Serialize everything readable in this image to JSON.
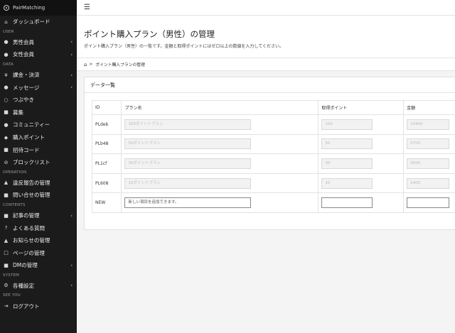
{
  "app": {
    "name": "PairMatching"
  },
  "sidebar": {
    "groups": [
      {
        "section": "",
        "items": [
          {
            "icon": "dashboard-icon",
            "glyph": "⌂",
            "label": "ダッシュボード",
            "chevron": false
          }
        ]
      },
      {
        "section": "USER",
        "items": [
          {
            "icon": "male-user-icon",
            "glyph": "●",
            "label": "男性会員",
            "chevron": true
          },
          {
            "icon": "female-user-icon",
            "glyph": "●",
            "label": "女性会員",
            "chevron": true
          }
        ]
      },
      {
        "section": "DATA",
        "items": [
          {
            "icon": "yen-icon",
            "glyph": "¥",
            "label": "課金・決済",
            "chevron": true
          },
          {
            "icon": "message-icon",
            "glyph": "●",
            "label": "メッセージ",
            "chevron": true
          },
          {
            "icon": "tweet-icon",
            "glyph": "○",
            "label": "つぶやき",
            "chevron": false
          },
          {
            "icon": "recruit-icon",
            "glyph": "■",
            "label": "募集",
            "chevron": false
          },
          {
            "icon": "community-icon",
            "glyph": "●",
            "label": "コミュニティー",
            "chevron": false
          },
          {
            "icon": "purchase-point-icon",
            "glyph": "◆",
            "label": "購入ポイント",
            "chevron": false
          },
          {
            "icon": "invite-code-icon",
            "glyph": "■",
            "label": "招待コード",
            "chevron": false
          },
          {
            "icon": "block-list-icon",
            "glyph": "⊘",
            "label": "ブロックリスト",
            "chevron": false
          }
        ]
      },
      {
        "section": "OPERATION",
        "items": [
          {
            "icon": "report-icon",
            "glyph": "▲",
            "label": "違反報告の管理",
            "chevron": false
          },
          {
            "icon": "inquiry-icon",
            "glyph": "■",
            "label": "問い合せの管理",
            "chevron": false
          }
        ]
      },
      {
        "section": "CONTENTS",
        "items": [
          {
            "icon": "article-icon",
            "glyph": "■",
            "label": "記事の管理",
            "chevron": true
          },
          {
            "icon": "faq-icon",
            "glyph": "?",
            "label": "よくある質問",
            "chevron": false
          },
          {
            "icon": "notice-icon",
            "glyph": "▲",
            "label": "お知らせの管理",
            "chevron": false
          },
          {
            "icon": "page-icon",
            "glyph": "□",
            "label": "ページの管理",
            "chevron": false
          },
          {
            "icon": "dm-icon",
            "glyph": "■",
            "label": "DMの管理",
            "chevron": true
          }
        ]
      },
      {
        "section": "SYSTEM",
        "items": [
          {
            "icon": "gear-icon",
            "glyph": "⚙",
            "label": "各種設定",
            "chevron": true
          }
        ]
      },
      {
        "section": "SEE YOU",
        "items": [
          {
            "icon": "logout-icon",
            "glyph": "⇥",
            "label": "ログアウト",
            "chevron": false
          }
        ]
      }
    ]
  },
  "header": {
    "title": "ポイント購入プラン（男性）の管理",
    "description": "ポイント購入プラン（男性）の一覧です。金額と取得ポイントにはゼロ以上の数値を入力してください。"
  },
  "breadcrumb": {
    "current": "ポイント購入プランの管理"
  },
  "card": {
    "title": "データ一覧",
    "columns": {
      "id": "ID",
      "plan_name": "プラン名",
      "points": "取得ポイント",
      "price": "金額"
    },
    "rows": [
      {
        "id": "PLdeb",
        "plan_name": "100ポイントプラン",
        "points": "100",
        "price": "10400"
      },
      {
        "id": "PLb48",
        "plan_name": "50ポイントプラン",
        "points": "50",
        "price": "5700"
      },
      {
        "id": "PL1cf",
        "plan_name": "30ポイントプラン",
        "points": "30",
        "price": "3500"
      },
      {
        "id": "PL608",
        "plan_name": "10ポイントプラン",
        "points": "10",
        "price": "1400"
      }
    ],
    "new_row": {
      "id": "NEW",
      "plan_name_placeholder": "新しい項目を追加できます。"
    }
  }
}
